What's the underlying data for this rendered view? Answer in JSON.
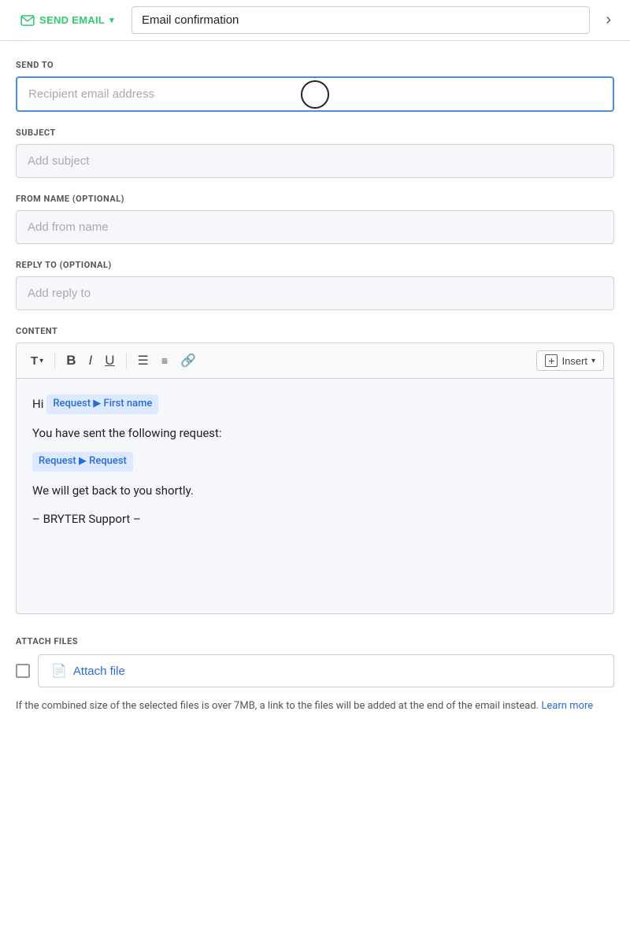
{
  "topBar": {
    "sendEmailLabel": "SEND EMAIL",
    "titleValue": "Email confirmation",
    "navArrow": "›"
  },
  "sendTo": {
    "label": "SEND TO",
    "placeholder": "Recipient email address"
  },
  "subject": {
    "label": "SUBJECT",
    "placeholder": "Add subject"
  },
  "fromName": {
    "label": "FROM NAME (OPTIONAL)",
    "placeholder": "Add from name"
  },
  "replyTo": {
    "label": "REPLY TO (OPTIONAL)",
    "placeholder": "Add reply to"
  },
  "content": {
    "label": "CONTENT",
    "toolbar": {
      "textStyleLabel": "T",
      "boldLabel": "B",
      "italicLabel": "I",
      "underlineLabel": "U",
      "insertLabel": "Insert"
    },
    "body": {
      "greeting": "Hi",
      "tag1": "Request ▶ First name",
      "line1": "You have sent the following request:",
      "tag2": "Request ▶ Request",
      "line2": "We will get back to you shortly.",
      "signature": "– BRYTER Support –"
    }
  },
  "attachFiles": {
    "label": "ATTACH FILES",
    "buttonLabel": "Attach file",
    "note": "If the combined size of the selected files is over 7MB, a link to the files will be added at the end of the email instead.",
    "learnMore": "Learn more"
  }
}
